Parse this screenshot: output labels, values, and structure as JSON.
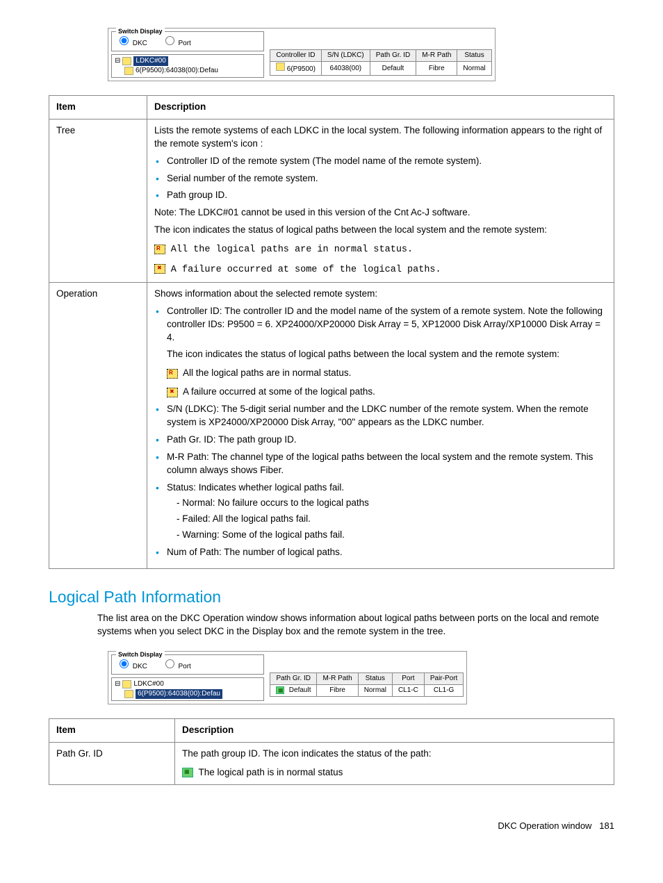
{
  "figure1": {
    "switch_legend": "Switch Display",
    "opt_dkc": "DKC",
    "opt_port": "Port",
    "tree_root": "LDKC#00",
    "tree_child": "6(P9500):64038(00):Defau",
    "headers": [
      "Controller ID",
      "S/N (LDKC)",
      "Path Gr. ID",
      "M-R Path",
      "Status"
    ],
    "row": [
      "6(P9500)",
      "64038(00)",
      "Default",
      "Fibre",
      "Normal"
    ]
  },
  "table1": {
    "h_item": "Item",
    "h_desc": "Description",
    "r1_item": "Tree",
    "r1_p1": "Lists the remote systems of each LDKC in the local system. The following information appears to the right of the remote system's icon :",
    "r1_b1": "Controller ID of the remote system (The model name of the remote system).",
    "r1_b2": "Serial number of the remote system.",
    "r1_b3": "Path group ID.",
    "r1_note": "Note: The LDKC#01 cannot be used in this version of the Cnt Ac-J software.",
    "r1_p2": "The icon indicates the status of logical paths between the local system and the remote system:",
    "r1_icon1": "All the logical paths are in normal status.",
    "r1_icon2": "A failure occurred at some of the logical paths.",
    "r2_item": "Operation",
    "r2_p1": "Shows information about the selected remote system:",
    "r2_b1": "Controller ID: The controller ID and the model name of the system of a remote system. Note the following controller IDs: P9500 = 6. XP24000/XP20000 Disk Array = 5, XP12000 Disk Array/XP10000 Disk Array = 4.",
    "r2_p2": "The icon indicates the status of logical paths between the local system and the remote system:",
    "r2_icon1": "All the logical paths are in normal status.",
    "r2_icon2": "A failure occurred at some of the logical paths.",
    "r2_b2": "S/N (LDKC): The 5-digit serial number and the LDKC number of the remote system. When the remote system is XP24000/XP20000 Disk Array, \"00\" appears as the LDKC number.",
    "r2_b3": "Path Gr. ID: The path group ID.",
    "r2_b4": "M-R Path: The channel type of the logical paths between the local system and the remote system. This column always shows Fiber.",
    "r2_b5": "Status: Indicates whether logical paths fail.",
    "r2_s1": "- Normal: No failure occurs to the logical paths",
    "r2_s2": "- Failed: All the logical paths fail.",
    "r2_s3": "- Warning: Some of the logical paths fail.",
    "r2_b6": "Num of Path: The number of logical paths."
  },
  "section_title": "Logical Path Information",
  "section_para": "The list area on the DKC Operation window shows information about logical paths between ports on the local and remote systems when you select DKC in the Display box and the remote system in the tree.",
  "figure2": {
    "switch_legend": "Switch Display",
    "opt_dkc": "DKC",
    "opt_port": "Port",
    "tree_root": "LDKC#00",
    "tree_child": "6(P9500):64038(00):Defau",
    "headers": [
      "Path Gr. ID",
      "M-R Path",
      "Status",
      "Port",
      "Pair-Port"
    ],
    "row": [
      "Default",
      "Fibre",
      "Normal",
      "CL1-C",
      "CL1-G"
    ]
  },
  "table2": {
    "h_item": "Item",
    "h_desc": "Description",
    "r1_item": "Path Gr. ID",
    "r1_p1": "The path group ID. The icon indicates the status of the path:",
    "r1_icon1": "The logical path is in normal status"
  },
  "footer_text": "DKC Operation window",
  "footer_page": "181"
}
